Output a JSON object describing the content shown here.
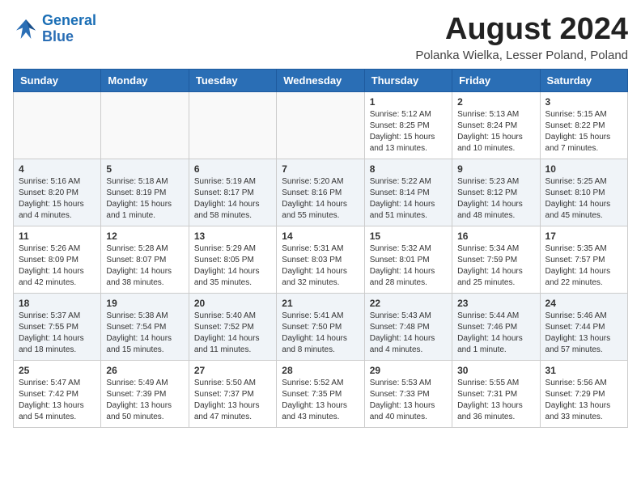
{
  "header": {
    "logo_line1": "General",
    "logo_line2": "Blue",
    "month_year": "August 2024",
    "location": "Polanka Wielka, Lesser Poland, Poland"
  },
  "days_of_week": [
    "Sunday",
    "Monday",
    "Tuesday",
    "Wednesday",
    "Thursday",
    "Friday",
    "Saturday"
  ],
  "weeks": [
    [
      {
        "day": "",
        "info": ""
      },
      {
        "day": "",
        "info": ""
      },
      {
        "day": "",
        "info": ""
      },
      {
        "day": "",
        "info": ""
      },
      {
        "day": "1",
        "info": "Sunrise: 5:12 AM\nSunset: 8:25 PM\nDaylight: 15 hours\nand 13 minutes."
      },
      {
        "day": "2",
        "info": "Sunrise: 5:13 AM\nSunset: 8:24 PM\nDaylight: 15 hours\nand 10 minutes."
      },
      {
        "day": "3",
        "info": "Sunrise: 5:15 AM\nSunset: 8:22 PM\nDaylight: 15 hours\nand 7 minutes."
      }
    ],
    [
      {
        "day": "4",
        "info": "Sunrise: 5:16 AM\nSunset: 8:20 PM\nDaylight: 15 hours\nand 4 minutes."
      },
      {
        "day": "5",
        "info": "Sunrise: 5:18 AM\nSunset: 8:19 PM\nDaylight: 15 hours\nand 1 minute."
      },
      {
        "day": "6",
        "info": "Sunrise: 5:19 AM\nSunset: 8:17 PM\nDaylight: 14 hours\nand 58 minutes."
      },
      {
        "day": "7",
        "info": "Sunrise: 5:20 AM\nSunset: 8:16 PM\nDaylight: 14 hours\nand 55 minutes."
      },
      {
        "day": "8",
        "info": "Sunrise: 5:22 AM\nSunset: 8:14 PM\nDaylight: 14 hours\nand 51 minutes."
      },
      {
        "day": "9",
        "info": "Sunrise: 5:23 AM\nSunset: 8:12 PM\nDaylight: 14 hours\nand 48 minutes."
      },
      {
        "day": "10",
        "info": "Sunrise: 5:25 AM\nSunset: 8:10 PM\nDaylight: 14 hours\nand 45 minutes."
      }
    ],
    [
      {
        "day": "11",
        "info": "Sunrise: 5:26 AM\nSunset: 8:09 PM\nDaylight: 14 hours\nand 42 minutes."
      },
      {
        "day": "12",
        "info": "Sunrise: 5:28 AM\nSunset: 8:07 PM\nDaylight: 14 hours\nand 38 minutes."
      },
      {
        "day": "13",
        "info": "Sunrise: 5:29 AM\nSunset: 8:05 PM\nDaylight: 14 hours\nand 35 minutes."
      },
      {
        "day": "14",
        "info": "Sunrise: 5:31 AM\nSunset: 8:03 PM\nDaylight: 14 hours\nand 32 minutes."
      },
      {
        "day": "15",
        "info": "Sunrise: 5:32 AM\nSunset: 8:01 PM\nDaylight: 14 hours\nand 28 minutes."
      },
      {
        "day": "16",
        "info": "Sunrise: 5:34 AM\nSunset: 7:59 PM\nDaylight: 14 hours\nand 25 minutes."
      },
      {
        "day": "17",
        "info": "Sunrise: 5:35 AM\nSunset: 7:57 PM\nDaylight: 14 hours\nand 22 minutes."
      }
    ],
    [
      {
        "day": "18",
        "info": "Sunrise: 5:37 AM\nSunset: 7:55 PM\nDaylight: 14 hours\nand 18 minutes."
      },
      {
        "day": "19",
        "info": "Sunrise: 5:38 AM\nSunset: 7:54 PM\nDaylight: 14 hours\nand 15 minutes."
      },
      {
        "day": "20",
        "info": "Sunrise: 5:40 AM\nSunset: 7:52 PM\nDaylight: 14 hours\nand 11 minutes."
      },
      {
        "day": "21",
        "info": "Sunrise: 5:41 AM\nSunset: 7:50 PM\nDaylight: 14 hours\nand 8 minutes."
      },
      {
        "day": "22",
        "info": "Sunrise: 5:43 AM\nSunset: 7:48 PM\nDaylight: 14 hours\nand 4 minutes."
      },
      {
        "day": "23",
        "info": "Sunrise: 5:44 AM\nSunset: 7:46 PM\nDaylight: 14 hours\nand 1 minute."
      },
      {
        "day": "24",
        "info": "Sunrise: 5:46 AM\nSunset: 7:44 PM\nDaylight: 13 hours\nand 57 minutes."
      }
    ],
    [
      {
        "day": "25",
        "info": "Sunrise: 5:47 AM\nSunset: 7:42 PM\nDaylight: 13 hours\nand 54 minutes."
      },
      {
        "day": "26",
        "info": "Sunrise: 5:49 AM\nSunset: 7:39 PM\nDaylight: 13 hours\nand 50 minutes."
      },
      {
        "day": "27",
        "info": "Sunrise: 5:50 AM\nSunset: 7:37 PM\nDaylight: 13 hours\nand 47 minutes."
      },
      {
        "day": "28",
        "info": "Sunrise: 5:52 AM\nSunset: 7:35 PM\nDaylight: 13 hours\nand 43 minutes."
      },
      {
        "day": "29",
        "info": "Sunrise: 5:53 AM\nSunset: 7:33 PM\nDaylight: 13 hours\nand 40 minutes."
      },
      {
        "day": "30",
        "info": "Sunrise: 5:55 AM\nSunset: 7:31 PM\nDaylight: 13 hours\nand 36 minutes."
      },
      {
        "day": "31",
        "info": "Sunrise: 5:56 AM\nSunset: 7:29 PM\nDaylight: 13 hours\nand 33 minutes."
      }
    ]
  ]
}
